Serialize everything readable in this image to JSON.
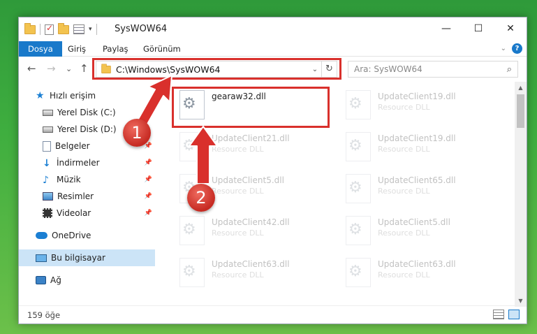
{
  "window": {
    "title": "SysWOW64",
    "controls": {
      "minimize": "—",
      "maximize": "☐",
      "close": "✕"
    }
  },
  "ribbon": {
    "tabs": [
      {
        "label": "Dosya",
        "active": true
      },
      {
        "label": "Giriş",
        "active": false
      },
      {
        "label": "Paylaş",
        "active": false
      },
      {
        "label": "Görünüm",
        "active": false
      }
    ],
    "help": "?"
  },
  "nav": {
    "back": "←",
    "forward": "→",
    "recent": "⌄",
    "up": "↑",
    "address": "C:\\Windows\\SysWOW64",
    "refresh": "↻",
    "search_placeholder": "Ara: SysWOW64",
    "search_icon": "⌕"
  },
  "sidebar": {
    "items": [
      {
        "label": "Hızlı erişim",
        "icon": "star-icon"
      },
      {
        "label": "Yerel Disk (C:)",
        "icon": "drive-icon"
      },
      {
        "label": "Yerel Disk (D:)",
        "icon": "drive-icon"
      },
      {
        "label": "Belgeler",
        "icon": "document-icon"
      },
      {
        "label": "İndirmeler",
        "icon": "download-icon"
      },
      {
        "label": "Müzik",
        "icon": "music-icon"
      },
      {
        "label": "Resimler",
        "icon": "pictures-icon"
      },
      {
        "label": "Videolar",
        "icon": "videos-icon"
      },
      {
        "label": "OneDrive",
        "icon": "cloud-icon"
      },
      {
        "label": "Bu bilgisayar",
        "icon": "computer-icon",
        "selected": true
      },
      {
        "label": "Ağ",
        "icon": "network-icon"
      }
    ],
    "pin": "📌"
  },
  "files": [
    {
      "name": "gearaw32.dll",
      "type": ""
    },
    {
      "name": "UpdateClient19.dll",
      "type": "Resource DLL"
    },
    {
      "name": "UpdateClient21.dll",
      "type": "Resource DLL"
    },
    {
      "name": "UpdateClient19.dll",
      "type": "Resource DLL"
    },
    {
      "name": "UpdateClient5.dll",
      "type": "Resource DLL"
    },
    {
      "name": "UpdateClient65.dll",
      "type": "Resource DLL"
    },
    {
      "name": "UpdateClient42.dll",
      "type": "Resource DLL"
    },
    {
      "name": "UpdateClient5.dll",
      "type": "Resource DLL"
    },
    {
      "name": "UpdateClient63.dll",
      "type": "Resource DLL"
    },
    {
      "name": "UpdateClient63.dll",
      "type": "Resource DLL"
    }
  ],
  "status": {
    "count": "159 öğe"
  },
  "annotations": {
    "step1": "1",
    "step2": "2",
    "color": "#d9302c"
  }
}
